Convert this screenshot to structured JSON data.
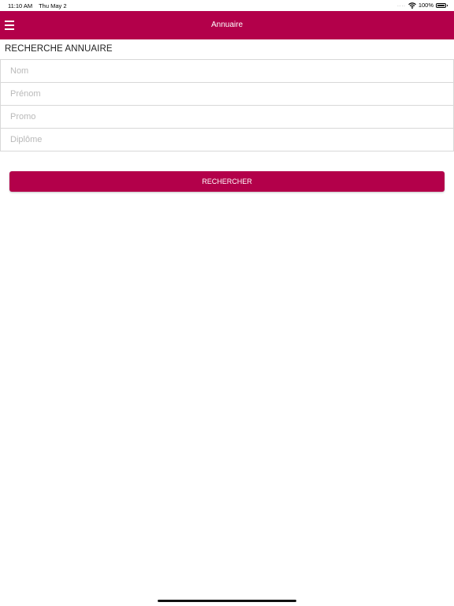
{
  "status_bar": {
    "time": "11:10 AM",
    "date": "Thu May 2",
    "signal": "....",
    "battery_text": "100%",
    "battery_level": 1.0
  },
  "navbar": {
    "title": "Annuaire",
    "menu_icon": "hamburger-menu-icon",
    "color": "#b3004a"
  },
  "form": {
    "title": "RECHERCHE ANNUAIRE",
    "fields": [
      {
        "placeholder": "Nom"
      },
      {
        "placeholder": "Prénom"
      },
      {
        "placeholder": "Promo"
      },
      {
        "placeholder": "Diplôme"
      }
    ],
    "submit_label": "RECHERCHER"
  }
}
